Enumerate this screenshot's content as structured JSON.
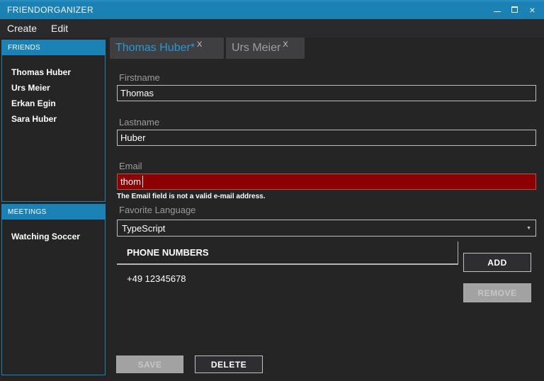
{
  "window": {
    "title": "FRIENDORGANIZER"
  },
  "menu": {
    "create": "Create",
    "edit": "Edit"
  },
  "sidebar": {
    "friends": {
      "header": "FRIENDS",
      "items": [
        "Thomas Huber",
        "Urs Meier",
        "Erkan Egin",
        "Sara Huber"
      ]
    },
    "meetings": {
      "header": "MEETINGS",
      "items": [
        "Watching Soccer"
      ]
    }
  },
  "tabs": {
    "active": {
      "label": "Thomas Huber*",
      "close": "X"
    },
    "inactive": {
      "label": "Urs Meier",
      "close": "X"
    }
  },
  "form": {
    "firstname": {
      "label": "Firstname",
      "value": "Thomas"
    },
    "lastname": {
      "label": "Lastname",
      "value": "Huber"
    },
    "email": {
      "label": "Email",
      "value": "thom",
      "error": "The Email field is not a valid e-mail address."
    },
    "favorite_language": {
      "label": "Favorite Language",
      "value": "TypeScript"
    },
    "phone_numbers": {
      "header": "PHONE NUMBERS",
      "items": [
        "+49 12345678"
      ],
      "add": "ADD",
      "remove": "REMOVE"
    },
    "save": "SAVE",
    "delete": "DELETE"
  },
  "colors": {
    "accent_blue": "#1c82b5",
    "window_bg": "#252526",
    "tab_bg": "#3f3f41",
    "active_tab_text": "#2a96d5",
    "error_bg": "#8b0000",
    "error_border": "#b05050",
    "disabled_bg": "#a2a2a2",
    "input_border": "#bdbdbd"
  }
}
